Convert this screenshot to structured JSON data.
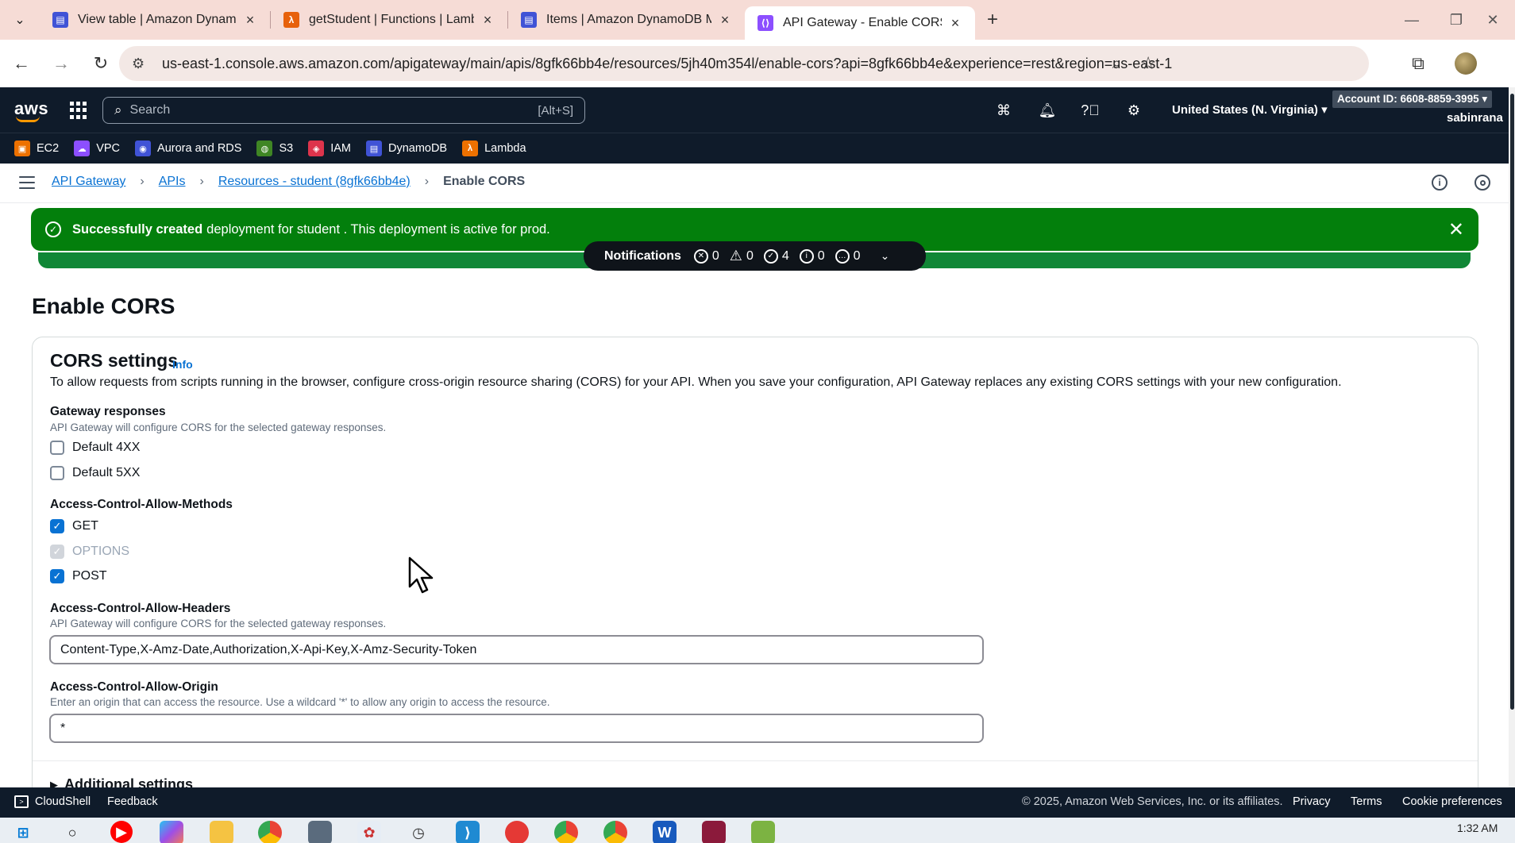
{
  "browser": {
    "tabs": [
      {
        "title": "View table | Amazon DynamoDB",
        "icon": "dynamodb-favicon",
        "color": "#4053d6"
      },
      {
        "title": "getStudent | Functions | Lambda",
        "icon": "lambda-favicon",
        "color": "#e7610b"
      },
      {
        "title": "Items | Amazon DynamoDB Ma",
        "icon": "dynamodb-favicon",
        "color": "#4053d6"
      },
      {
        "title": "API Gateway - Enable CORS",
        "icon": "api-gateway-favicon",
        "color": "#8c4fff"
      }
    ],
    "url": "us-east-1.console.aws.amazon.com/apigateway/main/apis/8gfk66bb4e/resources/5jh40m354l/enable-cors?api=8gfk66bb4e&experience=rest&region=us-east-1"
  },
  "aws_header": {
    "logo": "aws",
    "search_placeholder": "Search",
    "search_hint": "[Alt+S]",
    "region": "United States (N. Virginia) ▾",
    "account": "Account ID: 6608-8859-3995 ▾",
    "user": "sabinrana",
    "favorites": [
      {
        "label": "EC2",
        "color": "#ed7100",
        "icon": "ec2-icon"
      },
      {
        "label": "VPC",
        "color": "#8c4fff",
        "icon": "vpc-icon"
      },
      {
        "label": "Aurora and RDS",
        "color": "#4053d6",
        "icon": "rds-icon"
      },
      {
        "label": "S3",
        "color": "#3f8624",
        "icon": "s3-icon"
      },
      {
        "label": "IAM",
        "color": "#dd344c",
        "icon": "iam-icon"
      },
      {
        "label": "DynamoDB",
        "color": "#4053d6",
        "icon": "dynamodb-icon"
      },
      {
        "label": "Lambda",
        "color": "#ed7100",
        "icon": "lambda-icon"
      }
    ]
  },
  "breadcrumb": {
    "items": [
      "API Gateway",
      "APIs",
      "Resources - student (8gfk66bb4e)"
    ],
    "current": "Enable CORS"
  },
  "flash": {
    "bold": "Successfully created",
    "text": "deployment for student . This deployment is active for prod."
  },
  "notifications": {
    "label": "Notifications",
    "error": "0",
    "warning": "0",
    "success": "4",
    "info": "0",
    "progress": "0"
  },
  "page": {
    "title": "Enable CORS",
    "panel_title": "CORS settings",
    "info": "Info",
    "description": "To allow requests from scripts running in the browser, configure cross-origin resource sharing (CORS) for your API. When you save your configuration, API Gateway replaces any existing CORS settings with your new configuration."
  },
  "gateway_responses": {
    "label": "Gateway responses",
    "desc": "API Gateway will configure CORS for the selected gateway responses.",
    "options": [
      {
        "label": "Default 4XX",
        "checked": false,
        "disabled": false
      },
      {
        "label": "Default 5XX",
        "checked": false,
        "disabled": false
      }
    ]
  },
  "methods": {
    "label": "Access-Control-Allow-Methods",
    "options": [
      {
        "label": "GET",
        "checked": true,
        "disabled": false
      },
      {
        "label": "OPTIONS",
        "checked": true,
        "disabled": true
      },
      {
        "label": "POST",
        "checked": true,
        "disabled": false
      }
    ]
  },
  "headers": {
    "label": "Access-Control-Allow-Headers",
    "desc": "API Gateway will configure CORS for the selected gateway responses.",
    "value": "Content-Type,X-Amz-Date,Authorization,X-Api-Key,X-Amz-Security-Token"
  },
  "origin": {
    "label": "Access-Control-Allow-Origin",
    "desc": "Enter an origin that can access the resource. Use a wildcard '*' to allow any origin to access the resource.",
    "value": "*"
  },
  "additional_settings": "Additional settings",
  "footer": {
    "cloudshell": "CloudShell",
    "feedback": "Feedback",
    "copyright": "© 2025, Amazon Web Services, Inc. or its affiliates.",
    "privacy": "Privacy",
    "terms": "Terms",
    "cookies": "Cookie preferences"
  },
  "taskbar": {
    "time": "1:32 AM",
    "apps": [
      "windows-start-icon",
      "search-icon",
      "youtube-icon",
      "copilot-icon",
      "file-explorer-icon",
      "chrome-icon",
      "calculator-icon",
      "paint-icon",
      "clock-icon",
      "vscode-icon",
      "tomato-icon",
      "chrome-icon",
      "chrome-icon",
      "word-icon",
      "winrar-icon",
      "notepad-icon"
    ]
  }
}
